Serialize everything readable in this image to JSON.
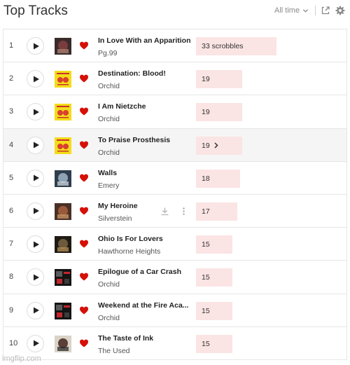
{
  "header": {
    "title": "Top Tracks",
    "time_filter": "All time",
    "icons": [
      "chevron-down-icon",
      "share-icon",
      "gear-icon"
    ]
  },
  "colors": {
    "heart": "#d51007",
    "bar": "#fbe4e4",
    "accent_text": "#222222"
  },
  "bar_scale_max": 33,
  "tracks": [
    {
      "rank": "1",
      "title": "In Love With an Apparition",
      "artist": "Pg.99",
      "scrobbles_label": "33 scrobbles",
      "scrobbles": 33
    },
    {
      "rank": "2",
      "title": "Destination: Blood!",
      "artist": "Orchid",
      "scrobbles_label": "19",
      "scrobbles": 19
    },
    {
      "rank": "3",
      "title": "I Am Nietzche",
      "artist": "Orchid",
      "scrobbles_label": "19",
      "scrobbles": 19
    },
    {
      "rank": "4",
      "title": "To Praise Prosthesis",
      "artist": "Orchid",
      "scrobbles_label": "19",
      "scrobbles": 19
    },
    {
      "rank": "5",
      "title": "Walls",
      "artist": "Emery",
      "scrobbles_label": "18",
      "scrobbles": 18
    },
    {
      "rank": "6",
      "title": "My Heroine",
      "artist": "Silverstein",
      "scrobbles_label": "17",
      "scrobbles": 17
    },
    {
      "rank": "7",
      "title": "Ohio Is For Lovers",
      "artist": "Hawthorne Heights",
      "scrobbles_label": "15",
      "scrobbles": 15
    },
    {
      "rank": "8",
      "title": "Epilogue of a Car Crash",
      "artist": "Orchid",
      "scrobbles_label": "15",
      "scrobbles": 15
    },
    {
      "rank": "9",
      "title": "Weekend at the Fire Aca...",
      "artist": "Orchid",
      "scrobbles_label": "15",
      "scrobbles": 15
    },
    {
      "rank": "10",
      "title": "The Taste of Ink",
      "artist": "The Used",
      "scrobbles_label": "15",
      "scrobbles": 15
    }
  ],
  "watermark": "imgflip.com"
}
